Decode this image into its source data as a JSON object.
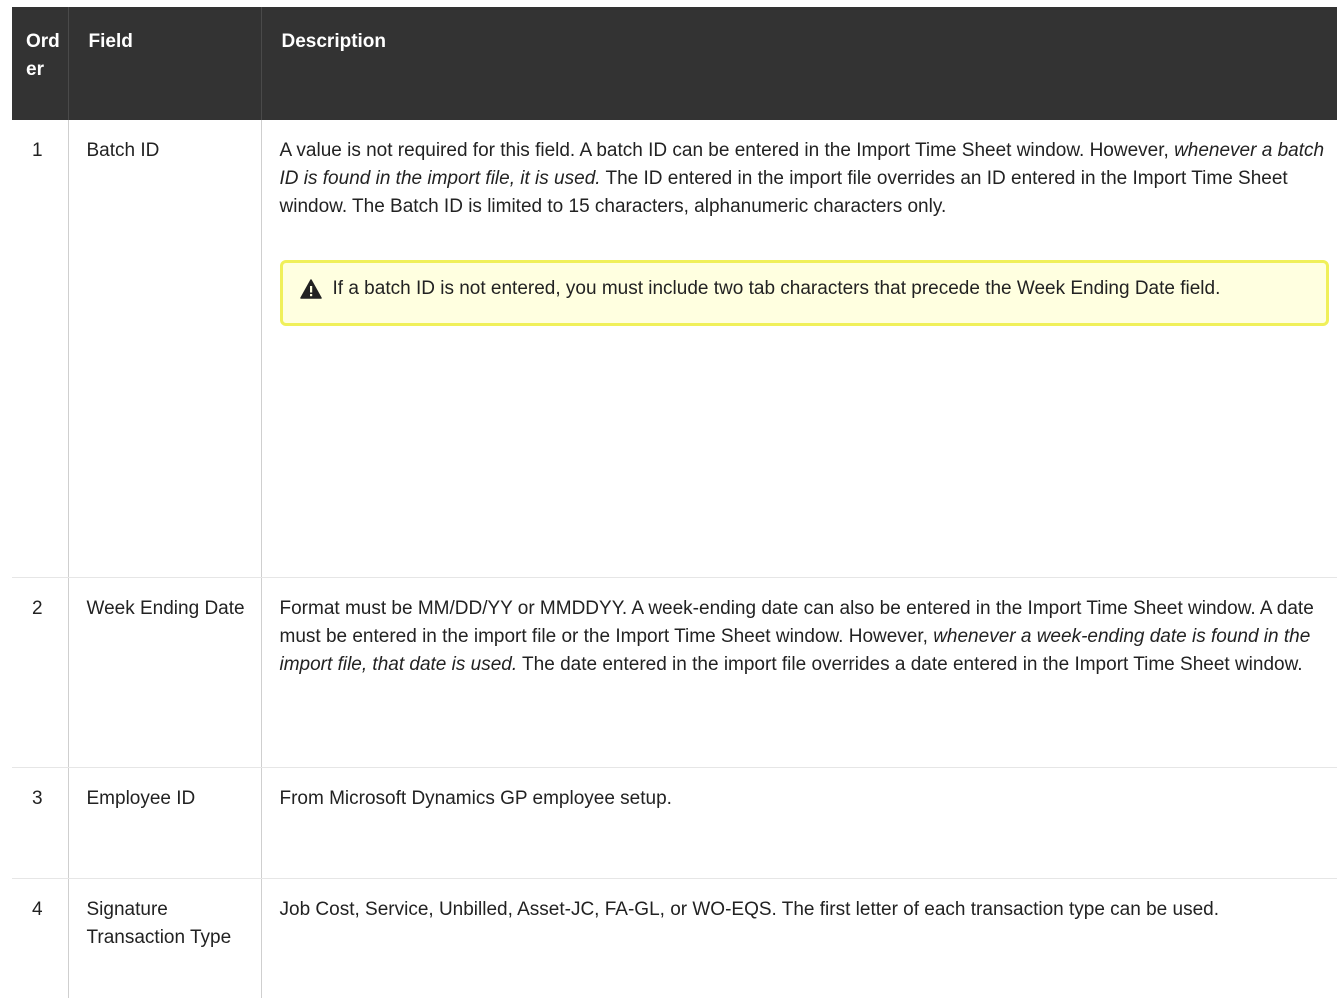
{
  "table": {
    "headers": {
      "order": "Order",
      "field": "Field",
      "description": "Description"
    },
    "rows": [
      {
        "order": "1",
        "field": "Batch ID",
        "desc": {
          "p1": "A value is not required for this field. A batch ID can be entered in the Import Time Sheet window. However, ",
          "italic": "whenever a batch ID is found in the import file, it is used.",
          "p2": " The ID entered in the import file overrides an ID entered in the Import Time Sheet window. The Batch ID is limited to 15 characters, alphanumeric characters only."
        },
        "note": {
          "icon": "warning-icon",
          "text": "If a batch ID is not entered, you must include two tab characters that precede the Week Ending Date field."
        }
      },
      {
        "order": "2",
        "field": "Week Ending Date",
        "desc": {
          "p1": "Format must be MM/DD/YY or MMDDYY. A week-ending date can also be entered in the Import Time Sheet window. A date must be entered in the import file or the Import Time Sheet window. However, ",
          "italic": "whenever a week-ending date is found in the import file, that date is used.",
          "p2": " The date entered in the import file overrides a date entered in the Import Time Sheet window."
        }
      },
      {
        "order": "3",
        "field": "Employee ID",
        "desc": {
          "p1": "From Microsoft Dynamics GP employee setup."
        }
      },
      {
        "order": "4",
        "field": "Signature Transaction Type",
        "desc": {
          "p1": "Job Cost, Service, Unbilled, Asset-JC, FA-GL, or WO-EQS. The first letter of each transaction type can be used."
        }
      }
    ]
  },
  "colors": {
    "header_bg": "#333333",
    "note_bg": "#ffffe0",
    "note_border": "#f0f05a"
  }
}
